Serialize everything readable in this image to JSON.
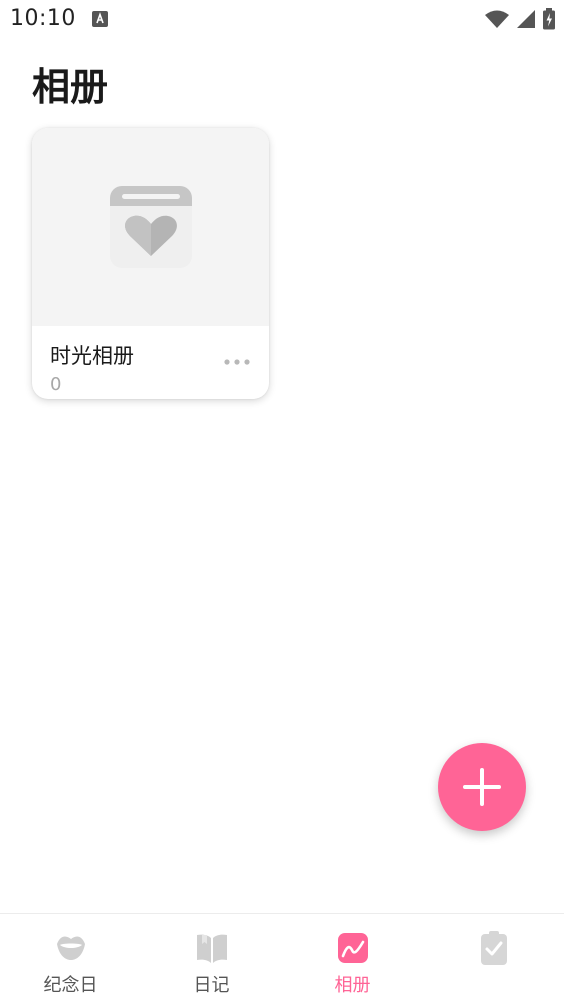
{
  "status_bar": {
    "time": "10:10",
    "notification_icon": "keyboard-a-icon",
    "icons": [
      "wifi-icon",
      "signal-icon",
      "battery-charging-icon"
    ]
  },
  "page": {
    "title": "相册"
  },
  "albums": [
    {
      "name": "时光相册",
      "count": "0",
      "cover_icon": "calendar-heart-icon",
      "menu_icon": "more-horizontal-icon"
    }
  ],
  "fab": {
    "icon": "plus-icon"
  },
  "bottom_nav": {
    "items": [
      {
        "label": "纪念日",
        "icon": "lips-icon",
        "active": false
      },
      {
        "label": "日记",
        "icon": "book-icon",
        "active": false
      },
      {
        "label": "相册",
        "icon": "photo-icon",
        "active": true
      },
      {
        "label": "",
        "icon": "checklist-icon",
        "active": false
      }
    ]
  },
  "colors": {
    "accent": "#ff6496",
    "nav_inactive": "#555555",
    "icon_gray": "#cfcfcf",
    "card_cover_bg": "#f4f4f4"
  }
}
